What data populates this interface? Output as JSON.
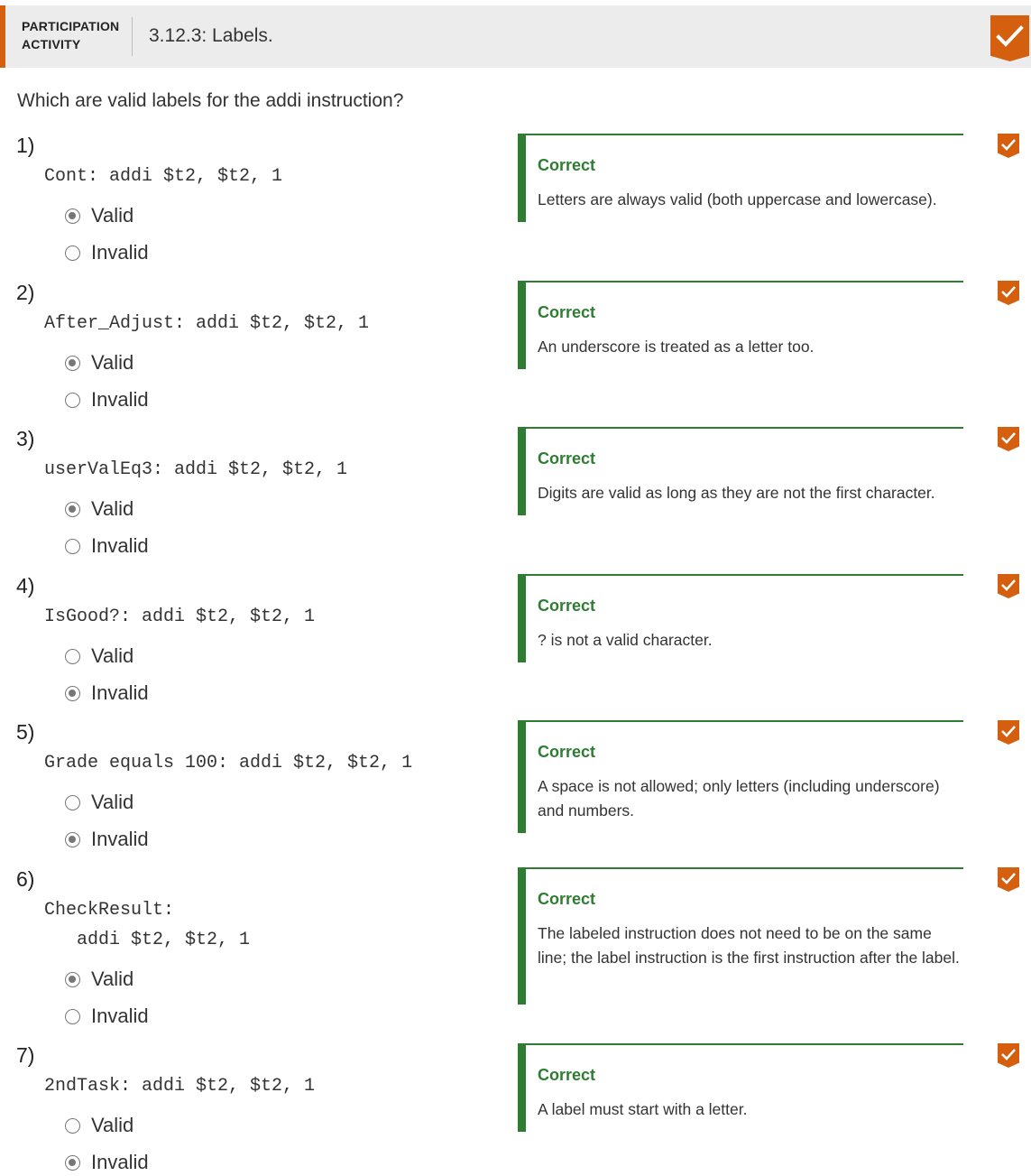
{
  "header": {
    "kind_line1": "PARTICIPATION",
    "kind_line2": "ACTIVITY",
    "title": "3.12.3: Labels.",
    "badge_icon": "checkmark-icon"
  },
  "prompt": "Which are valid labels for the addi instruction?",
  "accent_color": "#d35f0f",
  "correct_color": "#2e7d32",
  "questions": [
    {
      "number": "1)",
      "code_lines": [
        "Cont: addi $t2, $t2, 1"
      ],
      "options": [
        "Valid",
        "Invalid"
      ],
      "selected": "Valid",
      "feedback_title": "Correct",
      "feedback_text": "Letters are always valid (both uppercase and lowercase)."
    },
    {
      "number": "2)",
      "code_lines": [
        "After_Adjust: addi $t2, $t2, 1"
      ],
      "options": [
        "Valid",
        "Invalid"
      ],
      "selected": "Valid",
      "feedback_title": "Correct",
      "feedback_text": "An underscore is treated as a letter too."
    },
    {
      "number": "3)",
      "code_lines": [
        "userValEq3: addi $t2, $t2, 1"
      ],
      "options": [
        "Valid",
        "Invalid"
      ],
      "selected": "Valid",
      "feedback_title": "Correct",
      "feedback_text": "Digits are valid as long as they are not the first character."
    },
    {
      "number": "4)",
      "code_lines": [
        "IsGood?: addi $t2, $t2, 1"
      ],
      "options": [
        "Valid",
        "Invalid"
      ],
      "selected": "Invalid",
      "feedback_title": "Correct",
      "feedback_text": "? is not a valid character."
    },
    {
      "number": "5)",
      "code_lines": [
        "Grade equals 100: addi $t2, $t2, 1"
      ],
      "options": [
        "Valid",
        "Invalid"
      ],
      "selected": "Invalid",
      "feedback_title": "Correct",
      "feedback_text": "A space is not allowed; only letters (including underscore) and numbers."
    },
    {
      "number": "6)",
      "code_lines": [
        "CheckResult:",
        "   addi $t2, $t2, 1"
      ],
      "options": [
        "Valid",
        "Invalid"
      ],
      "selected": "Valid",
      "feedback_title": "Correct",
      "feedback_text": "The labeled instruction does not need to be on the same line; the label instruction is the first instruction after the label."
    },
    {
      "number": "7)",
      "code_lines": [
        "2ndTask: addi $t2, $t2, 1"
      ],
      "options": [
        "Valid",
        "Invalid"
      ],
      "selected": "Invalid",
      "feedback_title": "Correct",
      "feedback_text": "A label must start with a letter."
    }
  ]
}
